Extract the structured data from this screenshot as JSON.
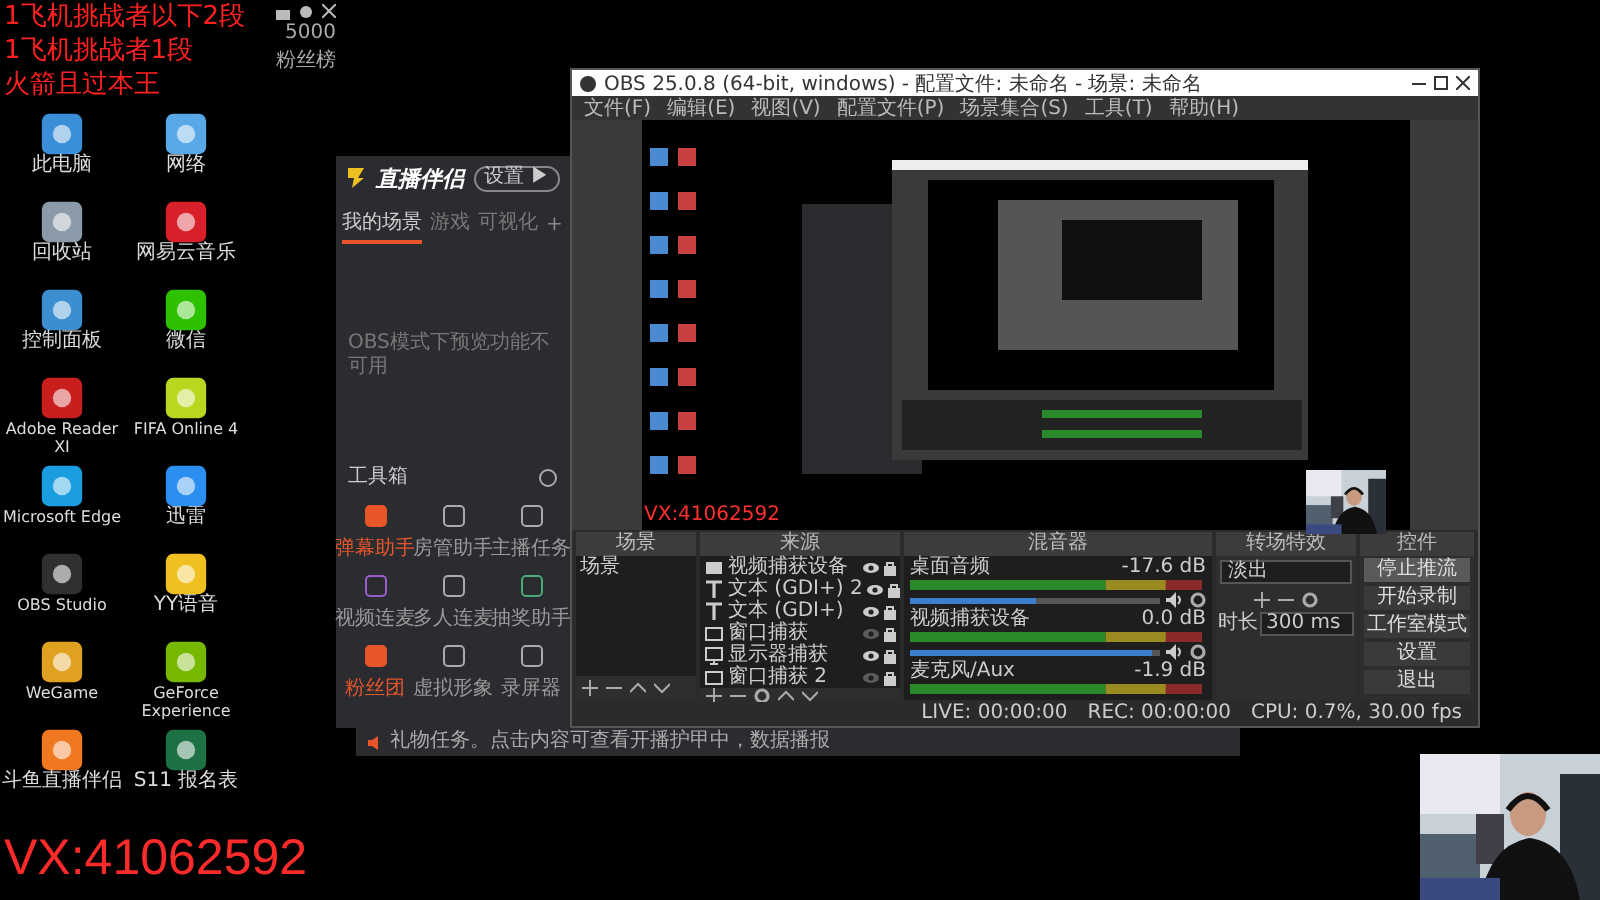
{
  "overlay_texts": [
    "1飞机挑战者以下2段",
    "1飞机挑战者1段",
    "火箭且过本王"
  ],
  "top_bar": {
    "count": "5000",
    "link": "粉丝榜"
  },
  "desktop_icons": [
    {
      "label": "此电脑",
      "color": "#3a8fd8"
    },
    {
      "label": "网络",
      "color": "#58a8e8"
    },
    {
      "label": "回收站",
      "color": "#8a9aa8"
    },
    {
      "label": "网易云音乐",
      "color": "#d8202a"
    },
    {
      "label": "控制面板",
      "color": "#3d8ed0"
    },
    {
      "label": "微信",
      "color": "#2dc100"
    },
    {
      "label": "Adobe Reader XI",
      "color": "#c81e1e"
    },
    {
      "label": "FIFA Online 4",
      "color": "#b8d820"
    },
    {
      "label": "Microsoft Edge",
      "color": "#1b9de2"
    },
    {
      "label": "迅雷",
      "color": "#2a8ff0"
    },
    {
      "label": "OBS Studio",
      "color": "#303030"
    },
    {
      "label": "YY语音",
      "color": "#f0c020"
    },
    {
      "label": "WeGame",
      "color": "#e0a020"
    },
    {
      "label": "GeForce Experience",
      "color": "#76b900"
    },
    {
      "label": "斗鱼直播伴侣",
      "color": "#f07820"
    },
    {
      "label": "S11 报名表",
      "color": "#1e7145"
    }
  ],
  "watermark": "VX:41062592",
  "assistant": {
    "logo": "直播伴侣",
    "pill": "设置 ▶",
    "tabs": [
      {
        "label": "我的场景",
        "selected": true
      },
      {
        "label": "游戏",
        "selected": false
      },
      {
        "label": "可视化",
        "selected": false
      }
    ],
    "add": "+",
    "notice": "OBS模式下预览功能不可用",
    "toolbox": "工具箱",
    "tools": [
      {
        "label": "弹幕助手",
        "selected": true
      },
      {
        "label": "房管助手",
        "selected": false
      },
      {
        "label": "主播任务",
        "selected": false
      },
      {
        "label": "视频连麦",
        "selected": false
      },
      {
        "label": "多人连麦",
        "selected": false
      },
      {
        "label": "抽奖助手",
        "selected": false
      },
      {
        "label": "粉丝团",
        "selected": true
      },
      {
        "label": "虚拟形象",
        "selected": false
      },
      {
        "label": "录屏器",
        "selected": false
      }
    ],
    "banner": "礼物任务。点击内容可查看开播护甲中，数据播报"
  },
  "obs": {
    "title": "OBS 25.0.8 (64-bit, windows) - 配置文件: 未命名 - 场景: 未命名",
    "menu": [
      "文件(F)",
      "编辑(E)",
      "视图(V)",
      "配置文件(P)",
      "场景集合(S)",
      "工具(T)",
      "帮助(H)"
    ],
    "preview_text": "VX:41062592",
    "scenes": {
      "title": "场景",
      "items": [
        "场景"
      ]
    },
    "sources": {
      "title": "来源",
      "items": [
        {
          "label": "视频捕获设备",
          "kind": "camera",
          "visible": true
        },
        {
          "label": "文本 (GDI+) 2",
          "kind": "text",
          "visible": true
        },
        {
          "label": "文本 (GDI+)",
          "kind": "text",
          "visible": true
        },
        {
          "label": "窗口捕获",
          "kind": "window",
          "visible": false
        },
        {
          "label": "显示器捕获",
          "kind": "monitor",
          "visible": true
        },
        {
          "label": "窗口捕获 2",
          "kind": "window",
          "visible": false
        }
      ]
    },
    "mixer": {
      "title": "混音器",
      "channels": [
        {
          "name": "桌面音频",
          "reading": "-17.6 dB",
          "level": 0.5
        },
        {
          "name": "视频捕获设备",
          "reading": "0.0 dB",
          "level": 0.97
        },
        {
          "name": "麦克风/Aux",
          "reading": "-1.9 dB"
        }
      ]
    },
    "transitions": {
      "title": "转场特效",
      "value": "淡出",
      "duration_label": "时长",
      "duration": "300 ms"
    },
    "controls": {
      "title": "控件",
      "buttons": [
        {
          "label": "停止推流",
          "selected": true
        },
        {
          "label": "开始录制",
          "selected": false
        },
        {
          "label": "工作室模式",
          "selected": false
        },
        {
          "label": "设置",
          "selected": false
        },
        {
          "label": "退出",
          "selected": false
        }
      ]
    },
    "status": {
      "live": "LIVE: 00:00:00",
      "rec": "REC: 00:00:00",
      "cpu": "CPU: 0.7%, 30.00 fps"
    }
  }
}
